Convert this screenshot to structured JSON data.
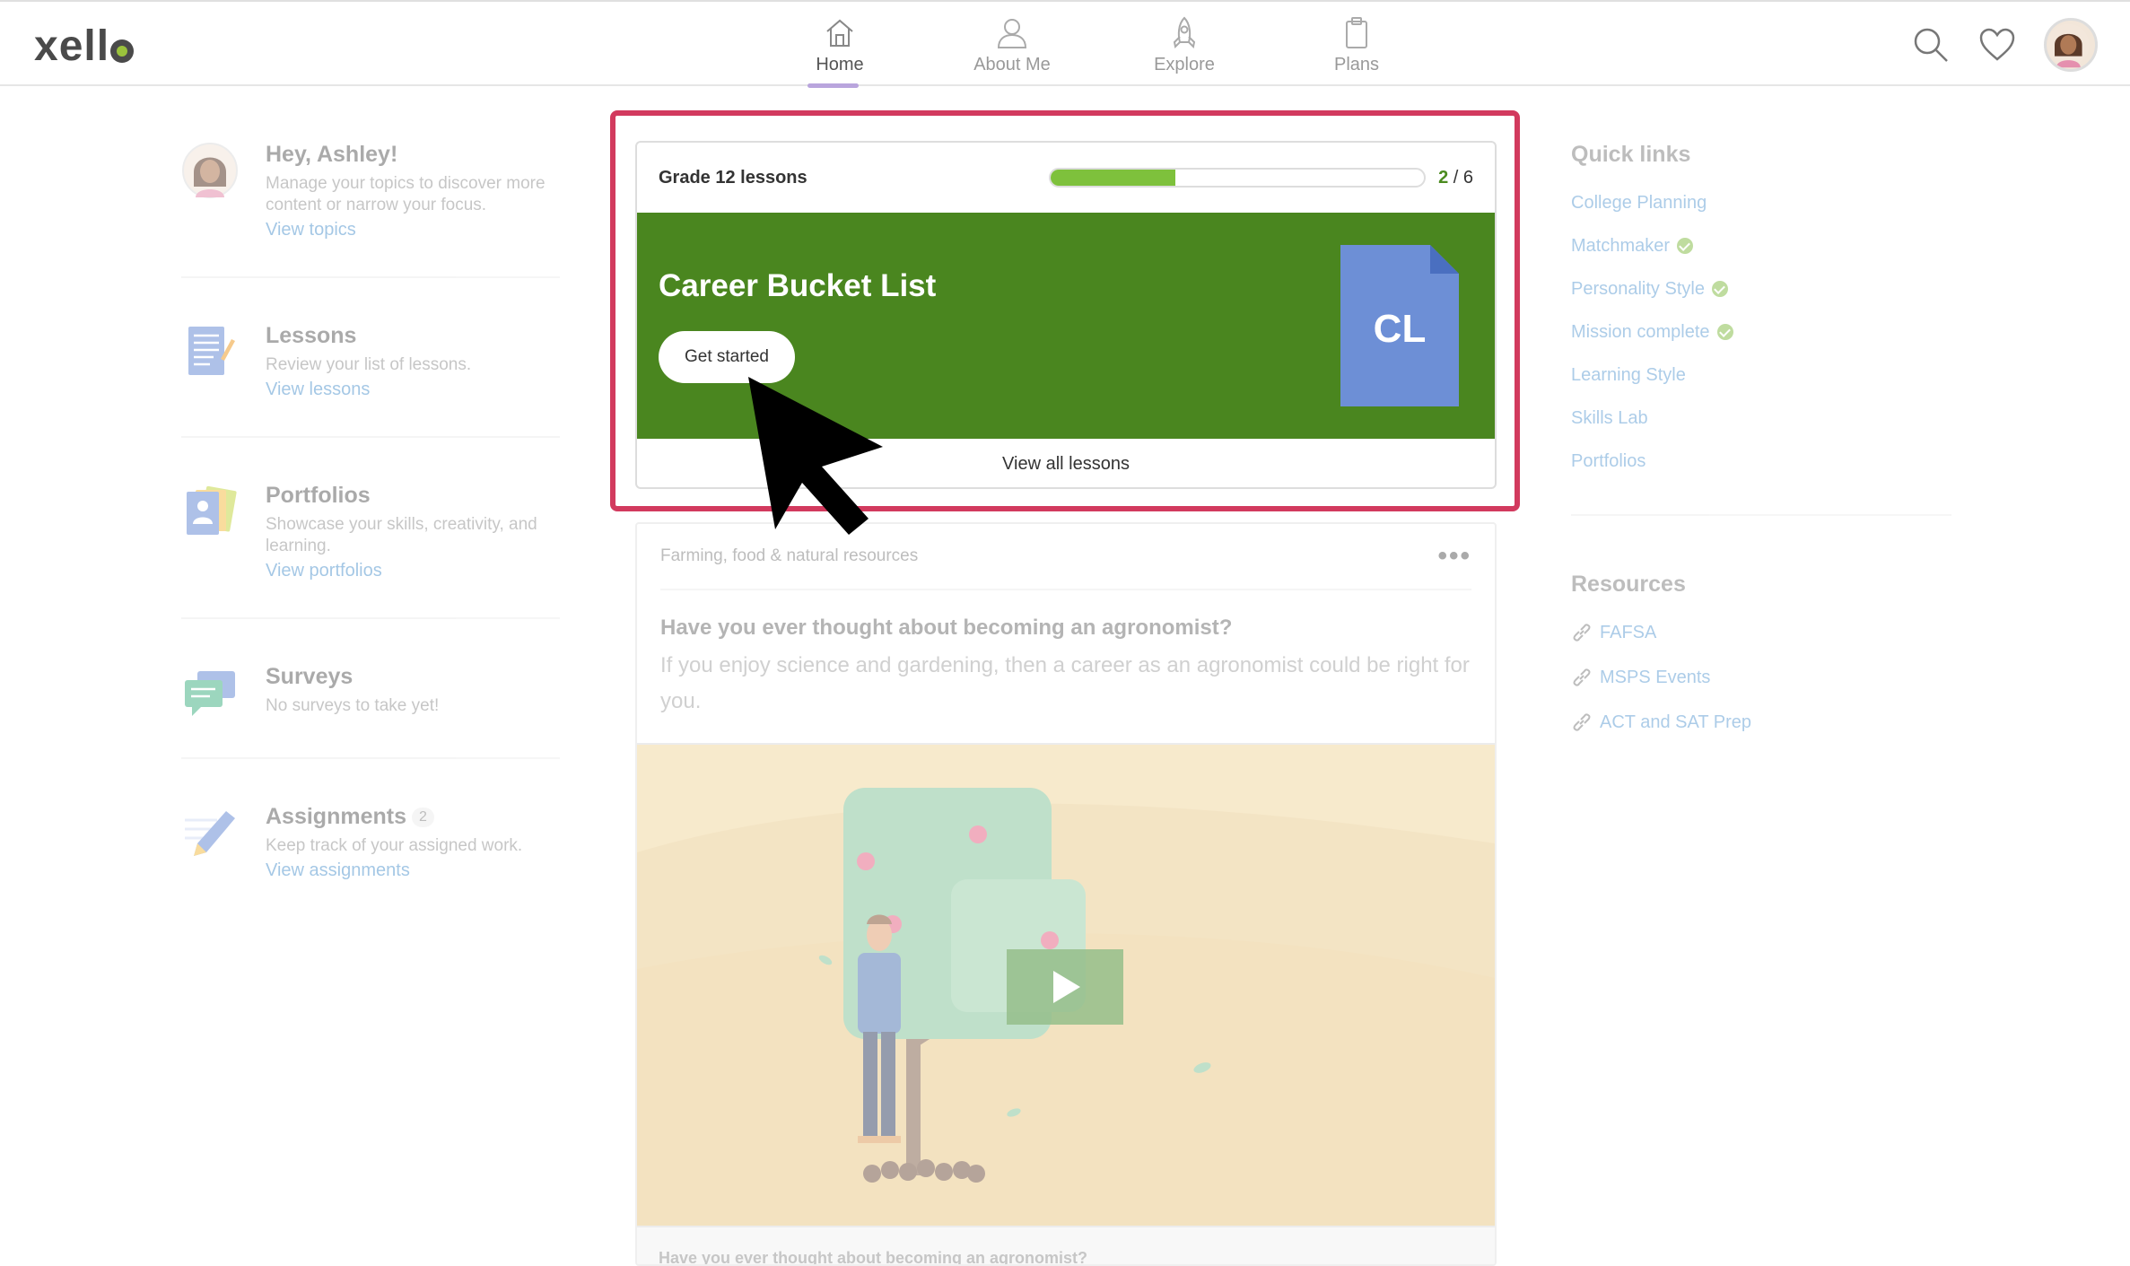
{
  "header": {
    "logo": "xello",
    "nav": [
      {
        "label": "Home",
        "active": true
      },
      {
        "label": "About Me",
        "active": false
      },
      {
        "label": "Explore",
        "active": false
      },
      {
        "label": "Plans",
        "active": false
      }
    ]
  },
  "left": {
    "greeting": {
      "title": "Hey, Ashley!",
      "desc": "Manage your topics to discover more content or narrow your focus.",
      "link": "View topics"
    },
    "lessons": {
      "title": "Lessons",
      "desc": "Review your list of lessons.",
      "link": "View lessons"
    },
    "portfolios": {
      "title": "Portfolios",
      "desc": "Showcase your skills, creativity, and learning.",
      "link": "View portfolios"
    },
    "surveys": {
      "title": "Surveys",
      "desc": "No surveys to take yet!"
    },
    "assignments": {
      "title": "Assignments",
      "count": "2",
      "desc": "Keep track of your assigned work.",
      "link": "View assignments"
    }
  },
  "lesson_card": {
    "title": "Grade 12 lessons",
    "progress_current": "2",
    "progress_sep": " / ",
    "progress_total": "6",
    "progress_fraction": 0.333,
    "banner_title": "Career Bucket List",
    "start_button": "Get started",
    "doc_abbrev": "CL",
    "view_all": "View all lessons",
    "banner_color": "#4a861f",
    "highlight_color": "#d23a5e"
  },
  "feed_card": {
    "category": "Farming, food & natural resources",
    "menu": "•••",
    "heading": "Have you ever thought about becoming an agronomist?",
    "body": "If you enjoy science and gardening, then a career as an agronomist could be right for you.",
    "footer": "Have you ever thought about becoming an agronomist?"
  },
  "right": {
    "quick_links_title": "Quick links",
    "quick_links": [
      {
        "label": "College Planning",
        "done": false
      },
      {
        "label": "Matchmaker",
        "done": true
      },
      {
        "label": "Personality Style",
        "done": true
      },
      {
        "label": "Mission complete",
        "done": true
      },
      {
        "label": "Learning Style",
        "done": false
      },
      {
        "label": "Skills Lab",
        "done": false
      },
      {
        "label": "Portfolios",
        "done": false
      }
    ],
    "resources_title": "Resources",
    "resources": [
      "FAFSA",
      "MSPS Events",
      "ACT and SAT Prep"
    ]
  }
}
